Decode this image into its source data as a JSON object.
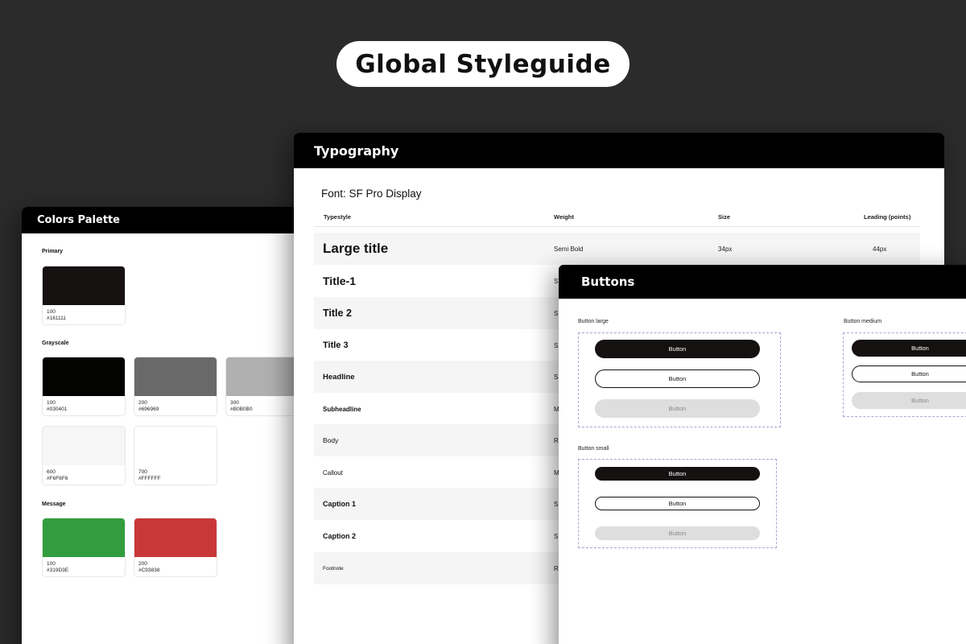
{
  "title": "Global Styleguide",
  "colors_panel": {
    "title": "Colors Palette",
    "groups": [
      {
        "label": "Primary",
        "swatches": [
          {
            "level": "100",
            "hex": "#161111",
            "color": "#161111"
          }
        ]
      },
      {
        "label": "Grayscale",
        "swatches": [
          {
            "level": "100",
            "hex": "#030401",
            "color": "#030401"
          },
          {
            "level": "200",
            "hex": "#696969",
            "color": "#696969"
          },
          {
            "level": "300",
            "hex": "#B0B0B0",
            "color": "#B0B0B0"
          },
          {
            "level": "600",
            "hex": "#F6F6F6",
            "color": "#F6F6F6"
          },
          {
            "level": "700",
            "hex": "#FFFFFF",
            "color": "#FFFFFF"
          }
        ]
      },
      {
        "label": "Message",
        "swatches": [
          {
            "level": "100",
            "hex": "#319D3E",
            "color": "#319D3E"
          },
          {
            "level": "200",
            "hex": "#C93838",
            "color": "#C93838"
          }
        ]
      }
    ]
  },
  "typography_panel": {
    "title": "Typography",
    "font_label": "Font: SF Pro Display",
    "headers": {
      "typestyle": "Typestyle",
      "weight": "Weight",
      "size": "Size",
      "leading": "Leading (points)"
    },
    "rows": [
      {
        "name": "Large title",
        "weight": "Semi Bold",
        "size": "34px",
        "leading": "44px"
      },
      {
        "name": "Title-1",
        "weight": "S"
      },
      {
        "name": "Title 2",
        "weight": "S"
      },
      {
        "name": "Title 3",
        "weight": "S"
      },
      {
        "name": "Headline",
        "weight": "S"
      },
      {
        "name": "Subheadline",
        "weight": "M"
      },
      {
        "name": "Body",
        "weight": "R"
      },
      {
        "name": "Callout",
        "weight": "M"
      },
      {
        "name": "Caption 1",
        "weight": "S"
      },
      {
        "name": "Caption 2",
        "weight": "S"
      },
      {
        "name": "Footnote",
        "weight": "R"
      }
    ]
  },
  "buttons_panel": {
    "title": "Buttons",
    "large_label": "Button large",
    "medium_label": "Button medium",
    "small_label": "Button small",
    "button_text": "Button"
  }
}
